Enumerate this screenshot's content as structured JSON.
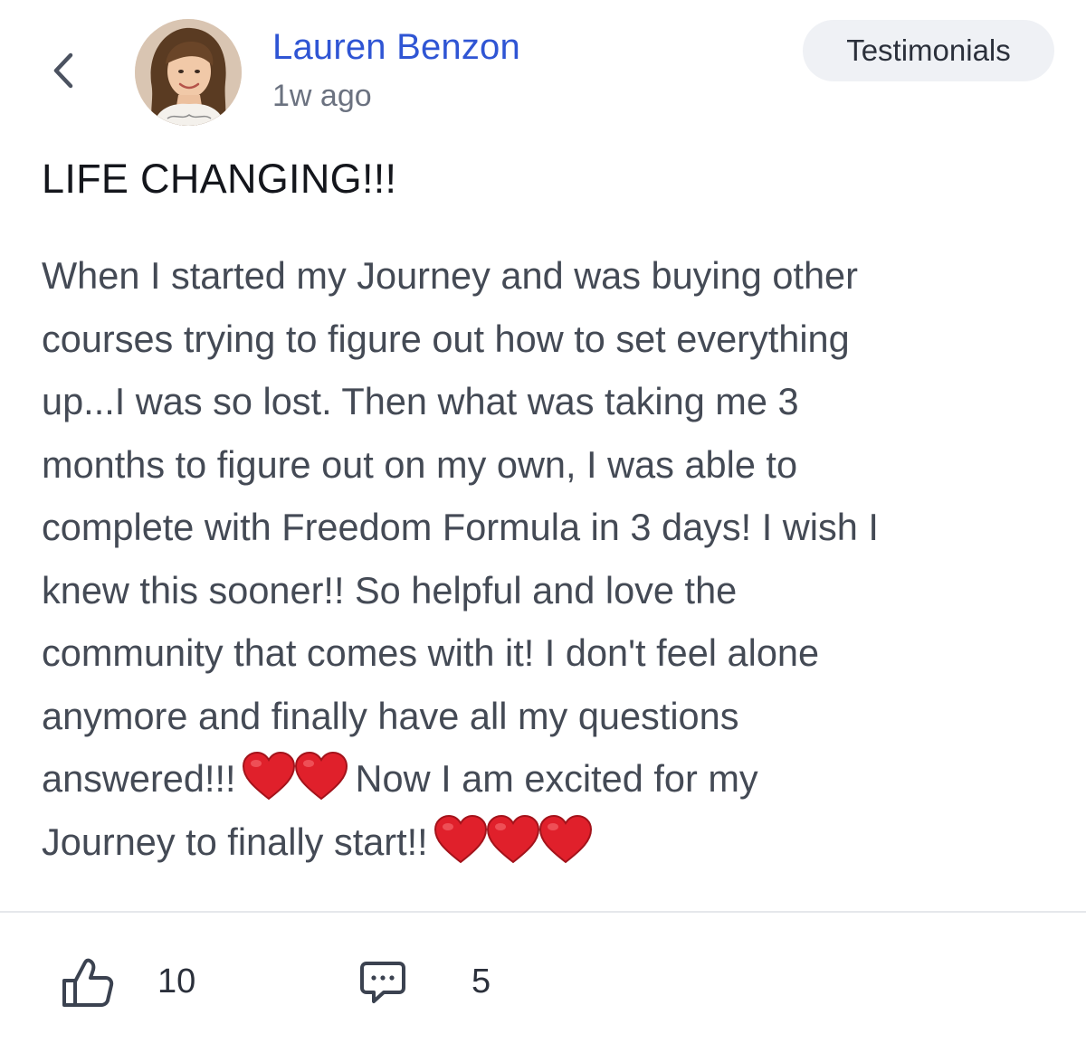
{
  "header": {
    "back_icon": "chevron-left-icon",
    "author": {
      "name": "Lauren Benzon",
      "time_ago": "1w ago",
      "avatar": "avatar-photo"
    },
    "category": "Testimonials"
  },
  "post": {
    "title": "LIFE CHANGING!!!",
    "body_lines": [
      "When I started my Journey and was buying other",
      "courses trying to figure out how to set everything",
      "up...I was so lost. Then what was taking me 3",
      "months to figure out on my own, I was able to",
      "complete with Freedom Formula in 3 days! I wish I",
      "knew this sooner!! So helpful and love the",
      "community that comes with it! I don't feel alone",
      "anymore and finally have all my questions"
    ],
    "line9_before": "answered!!!",
    "line9_after": "Now I am excited for my",
    "line10_before": "Journey to finally start!!",
    "heart_color": "#e0202b"
  },
  "footer": {
    "like_icon": "thumbs-up-icon",
    "likes": "10",
    "comment_icon": "comment-bubble-icon",
    "comments": "5"
  }
}
